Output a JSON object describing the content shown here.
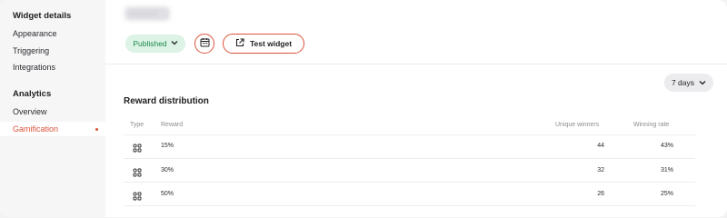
{
  "sidebar": {
    "groups": [
      {
        "title": "Widget details",
        "items": [
          "Appearance",
          "Triggering",
          "Integrations"
        ]
      },
      {
        "title": "Analytics",
        "items": [
          "Overview",
          "Gamification"
        ]
      }
    ],
    "active_item": "Gamification"
  },
  "header": {
    "status_label": "Published",
    "calendar_icon": "calendar-icon",
    "test_label": "Test widget",
    "test_icon": "external-link-icon"
  },
  "filter": {
    "range_label": "7 days"
  },
  "reward_distribution": {
    "title": "Reward distribution",
    "columns": [
      "Type",
      "Reward",
      "Unique winners",
      "Winning rate"
    ],
    "rows": [
      {
        "type_icon": "grid-icon",
        "reward": "15%",
        "unique_winners": "44",
        "winning_rate": "43%"
      },
      {
        "type_icon": "grid-icon",
        "reward": "30%",
        "unique_winners": "32",
        "winning_rate": "31%"
      },
      {
        "type_icon": "grid-icon",
        "reward": "50%",
        "unique_winners": "26",
        "winning_rate": "25%"
      }
    ]
  },
  "colors": {
    "accent": "#d9523b",
    "published_bg": "#dcf3e6",
    "published_text": "#1f8a4c"
  }
}
